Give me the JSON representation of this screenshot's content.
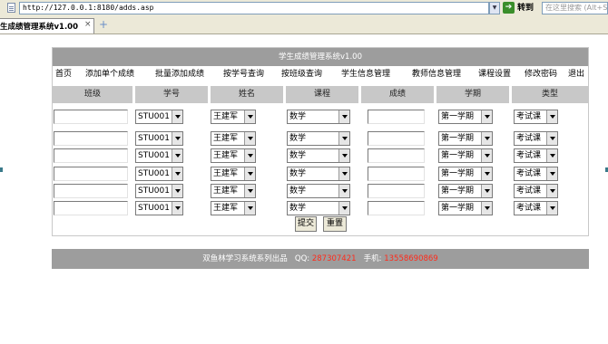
{
  "browser": {
    "url": "http://127.0.0.1:8180/adds.asp",
    "go_label": "转到",
    "search_placeholder": "在这里搜索 (Alt+S)",
    "tab_title": "生成绩管理系统v1.00",
    "tab_close": "×",
    "new_tab": "+"
  },
  "app": {
    "title": "学生成绩管理系统v1.00",
    "nav": [
      {
        "label": "首页"
      },
      {
        "label": "添加单个成绩"
      },
      {
        "label": "批量添加成绩"
      },
      {
        "label": "按学号查询"
      },
      {
        "label": "按班级查询"
      },
      {
        "label": "学生信息管理"
      },
      {
        "label": "教师信息管理"
      },
      {
        "label": "课程设置"
      },
      {
        "label": "修改密码"
      },
      {
        "label": "退出"
      }
    ],
    "columns": [
      "班级",
      "学号",
      "姓名",
      "课程",
      "成绩",
      "学期",
      "类型"
    ],
    "rows": [
      {
        "class": "",
        "student_id": "STU001",
        "name": "王建军",
        "course": "数学",
        "score": "",
        "term": "第一学期",
        "type": "考试课"
      },
      {
        "class": "",
        "student_id": "STU001",
        "name": "王建军",
        "course": "数学",
        "score": "",
        "term": "第一学期",
        "type": "考试课"
      },
      {
        "class": "",
        "student_id": "STU001",
        "name": "王建军",
        "course": "数学",
        "score": "",
        "term": "第一学期",
        "type": "考试课"
      },
      {
        "class": "",
        "student_id": "STU001",
        "name": "王建军",
        "course": "数学",
        "score": "",
        "term": "第一学期",
        "type": "考试课"
      },
      {
        "class": "",
        "student_id": "STU001",
        "name": "王建军",
        "course": "数学",
        "score": "",
        "term": "第一学期",
        "type": "考试课"
      },
      {
        "class": "",
        "student_id": "STU001",
        "name": "王建军",
        "course": "数学",
        "score": "",
        "term": "第一学期",
        "type": "考试课"
      }
    ],
    "submit_label": "提交",
    "reset_label": "重置"
  },
  "footer": {
    "text": "双鱼林学习系统系列出品",
    "qq_label": "QQ:",
    "qq_value": "287307421",
    "phone_label": "手机:",
    "phone_value": "13558690869"
  }
}
